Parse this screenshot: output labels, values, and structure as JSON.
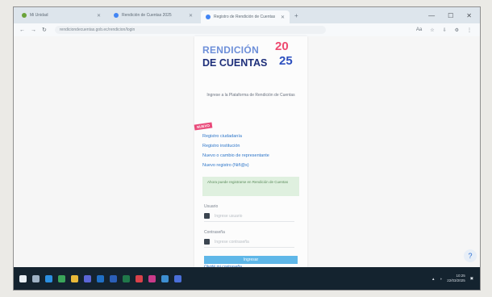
{
  "browser": {
    "tabs": [
      {
        "label": "Mi Unidad",
        "active": false
      },
      {
        "label": "Rendición de Cuentas 2025",
        "active": false
      },
      {
        "label": "Registro de Rendición de Cuentas",
        "active": true
      }
    ],
    "new_tab_glyph": "+",
    "window_controls": [
      "—",
      "☐",
      "✕"
    ],
    "nav": {
      "back": "←",
      "forward": "→",
      "reload": "↻"
    },
    "url": "rendiciondecuentas.gob.ec/rendicion/login",
    "tools": [
      "Aa",
      "☆",
      "⇩",
      "⚙",
      "⋮"
    ]
  },
  "page": {
    "logo": {
      "line1": "RENDICIÓN",
      "line2": "DE CUENTAS",
      "num_top": "20",
      "num_bottom": "25",
      "colors": {
        "primary": "#1e2f7a",
        "accent": "#ee4a70",
        "secondary": "#6d8fd9"
      }
    },
    "welcome_text": "Ingrese a la Plataforma de Rendición de Cuentas",
    "new_badge": "NUEVO",
    "links": [
      "Registro ciudadanía",
      "Registro institución",
      "Nuevo o cambio de representante",
      "Nuevo registro (Niñ@s)"
    ],
    "notice": "Ahora puede registrarse en Rendición de Cuentas",
    "username_label": "Usuario",
    "username_placeholder": "Ingrese usuario",
    "password_label": "Contraseña",
    "password_placeholder": "Ingrese contraseña",
    "submit_label": "Ingresar",
    "forgot_label": "Olvidé mi contraseña"
  },
  "help_glyph": "?",
  "taskbar": {
    "icons": [
      {
        "name": "windows-start-icon",
        "color": "#e8eef4"
      },
      {
        "name": "search-icon",
        "color": "#9fb2c5"
      },
      {
        "name": "edge-icon",
        "color": "#2b8fe0"
      },
      {
        "name": "chrome-icon",
        "color": "#3aa55a"
      },
      {
        "name": "file-explorer-icon",
        "color": "#e8b838"
      },
      {
        "name": "teams-icon",
        "color": "#5b66d6"
      },
      {
        "name": "outlook-icon",
        "color": "#1f6fc5"
      },
      {
        "name": "word-icon",
        "color": "#2b5fb8"
      },
      {
        "name": "excel-icon",
        "color": "#20784a"
      },
      {
        "name": "app-icon-1",
        "color": "#d9414a"
      },
      {
        "name": "app-icon-2",
        "color": "#c93a8a"
      },
      {
        "name": "app-icon-3",
        "color": "#3d8fd1"
      },
      {
        "name": "app-icon-4",
        "color": "#4a6fd8"
      }
    ],
    "time": "10:25",
    "date": "22/03/2025"
  }
}
